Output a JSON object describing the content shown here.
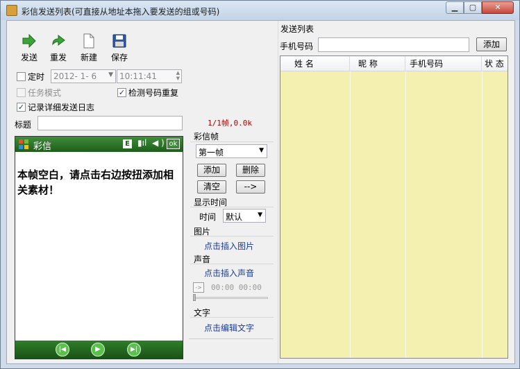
{
  "window": {
    "title": "彩信发送列表(可直接从地址本拖入要发送的组或号码)",
    "min_glyph": "▁",
    "max_glyph": "▢",
    "close_glyph": "✕"
  },
  "toolbar": {
    "send_label": "发送",
    "resend_label": "重发",
    "new_label": "新建",
    "save_label": "保存"
  },
  "schedule": {
    "timer_label": "定时",
    "date_value": "2012- 1- 6",
    "time_value": "10:11:41"
  },
  "options": {
    "task_mode_label": "任务模式",
    "detect_dup_label": "检测号码重复",
    "detailed_log_label": "记录详细发送日志"
  },
  "title_field": {
    "label": "标题",
    "value": "",
    "frame_info": "1/1帧,0.0k"
  },
  "phone": {
    "app_name": "彩信",
    "status_e": "E",
    "ok_label": "ok",
    "empty_message": "本帧空白，请点击右边按扭添加相关素材！"
  },
  "frame_panel": {
    "section_label": "彩信帧",
    "frame_select": "第一帧",
    "add_label": "添加",
    "delete_label": "删除",
    "clear_label": "清空",
    "next_label": "-->"
  },
  "display_time": {
    "section_label": "显示时间",
    "time_label": "时间",
    "time_select": "默认"
  },
  "image": {
    "section_label": "图片",
    "insert_link": "点击插入图片"
  },
  "sound": {
    "section_label": "声音",
    "insert_link": "点击插入声音",
    "play_glyph": "->",
    "time_display": "00:00 00:00"
  },
  "text": {
    "section_label": "文字",
    "edit_link": "点击编辑文字"
  },
  "send_list": {
    "section_label": "发送列表",
    "phone_label": "手机号码",
    "phone_value": "",
    "add_label": "添加",
    "columns": [
      "姓 名",
      "昵 称",
      "手机号码",
      "状 态"
    ]
  },
  "colors": {
    "title_bg": "#cfdbe9",
    "list_bg": "#f4f1b0",
    "phone_bar": "#2f7f2a",
    "link": "#1a3c9a",
    "frame_info": "#b00000"
  }
}
